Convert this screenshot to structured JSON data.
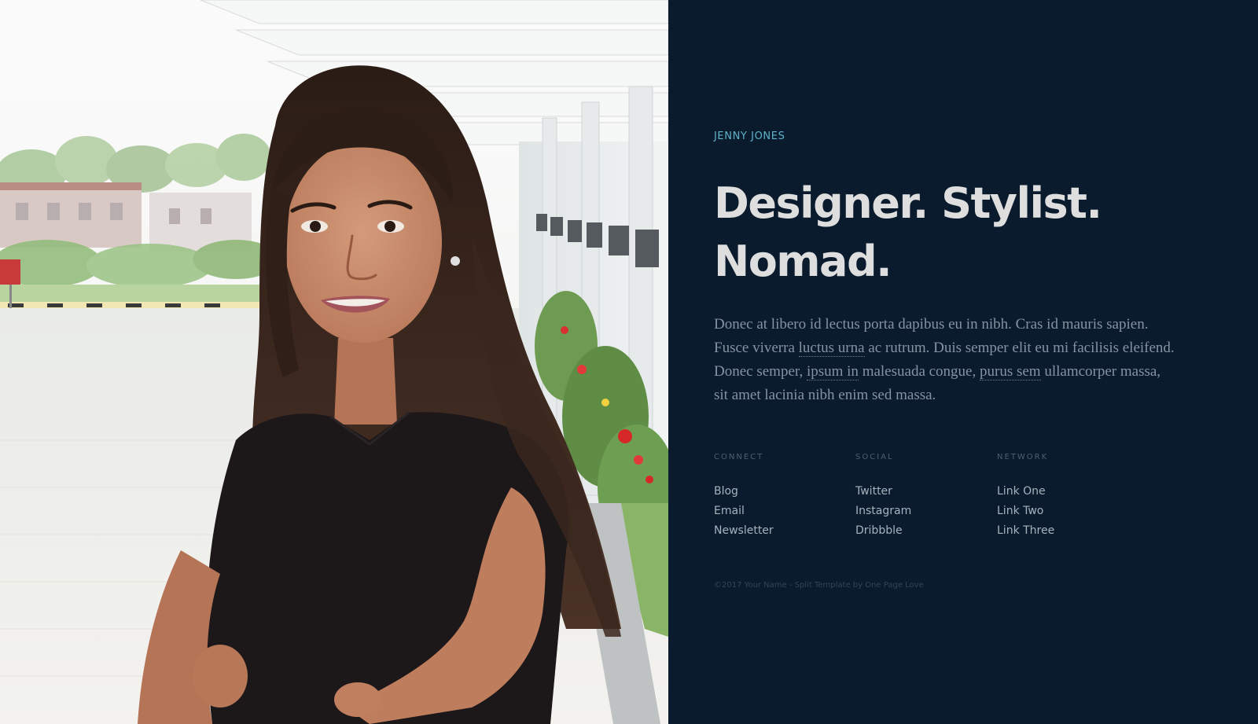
{
  "colors": {
    "background": "#0a1b2e",
    "accent": "#5fb3c9",
    "headline": "#dedede",
    "body_text": "#8593a2",
    "link_text": "#a7b2bd"
  },
  "photo": {
    "subject": "portrait photo"
  },
  "profile": {
    "name": "JENNY JONES",
    "headline_line1": "Designer. Stylist.",
    "headline_line2": "Nomad."
  },
  "bio": {
    "part1": "Donec at libero id lectus porta dapibus eu in nibh. Cras id mauris sapien. Fusce viverra ",
    "link1": "luctus urna",
    "part2": " ac rutrum. Duis semper elit eu mi facilisis eleifend. Donec semper, ",
    "link2": "ipsum in",
    "part3": " malesuada congue, ",
    "link3": "purus sem",
    "part4": " ullamcorper massa, sit amet lacinia nibh enim sed massa."
  },
  "columns": [
    {
      "heading": "CONNECT",
      "links": [
        "Blog",
        "Email",
        "Newsletter"
      ]
    },
    {
      "heading": "SOCIAL",
      "links": [
        "Twitter",
        "Instagram",
        "Dribbble"
      ]
    },
    {
      "heading": "NETWORK",
      "links": [
        "Link One",
        "Link Two",
        "Link Three"
      ]
    }
  ],
  "footer": {
    "text": "©2017 Your Name - Split Template by One Page Love"
  }
}
